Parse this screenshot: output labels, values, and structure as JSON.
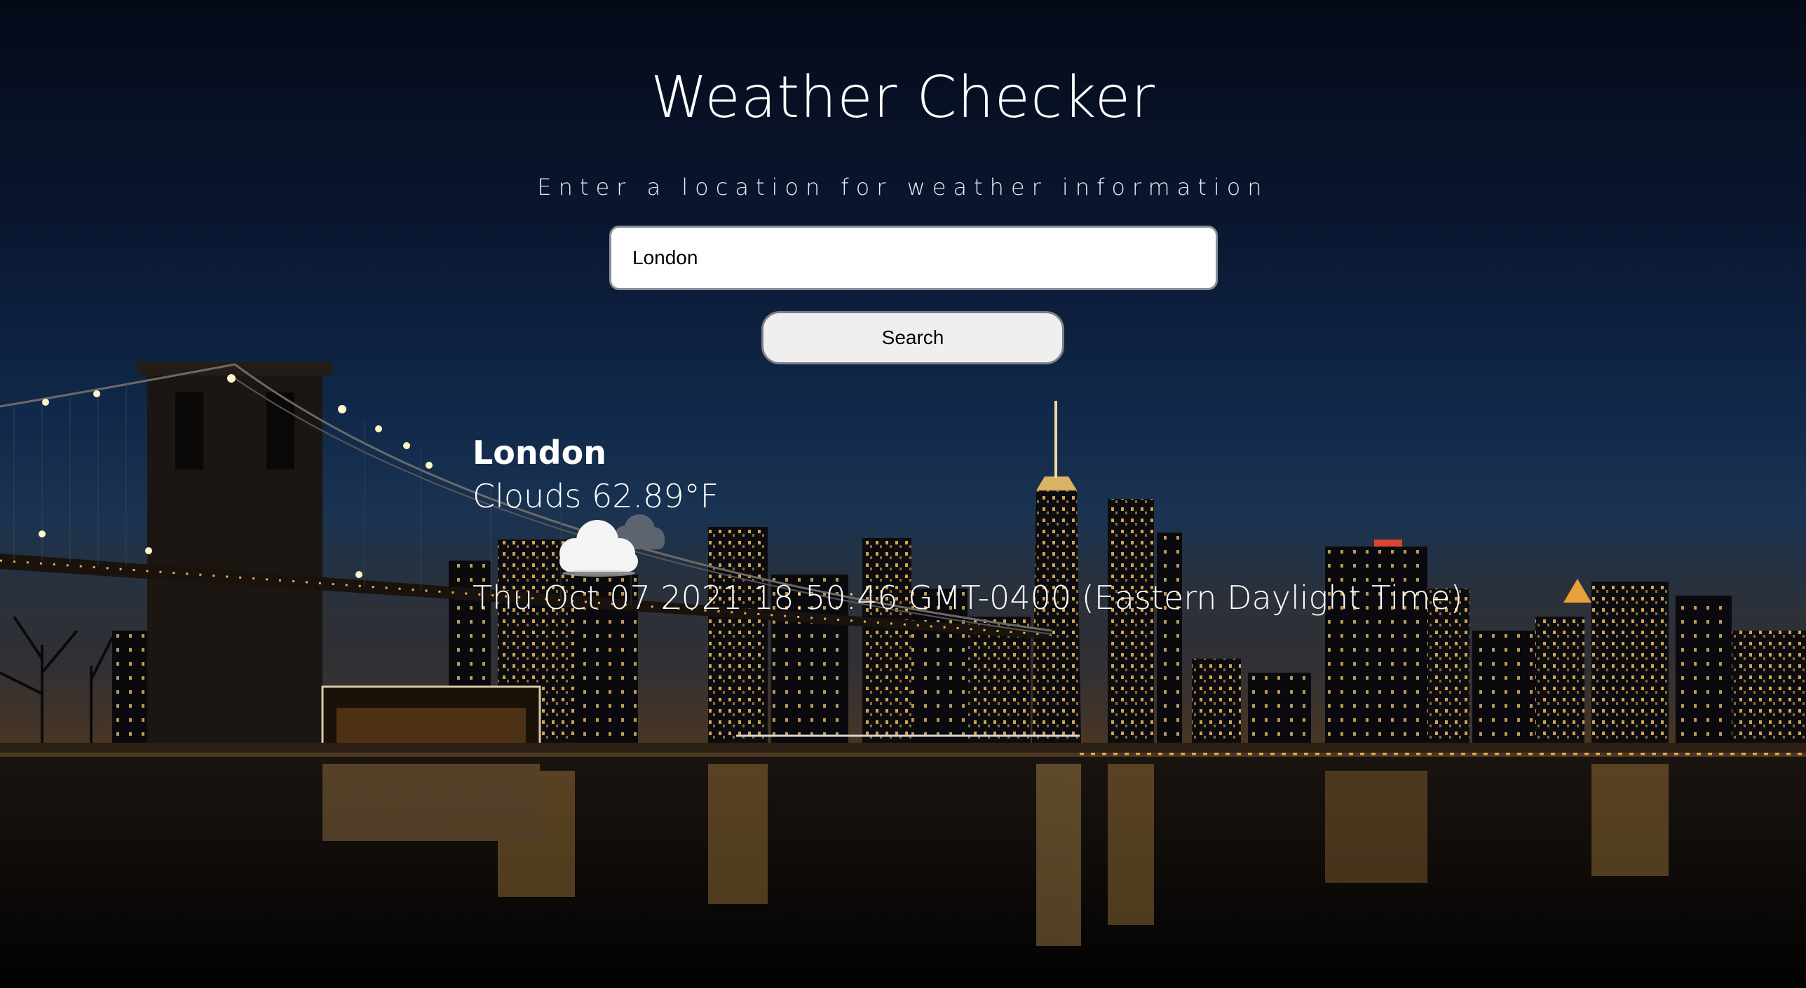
{
  "header": {
    "title": "Weather Checker",
    "subtitle": "Enter a location for weather information"
  },
  "search": {
    "value": "London",
    "button_label": "Search"
  },
  "result": {
    "city": "London",
    "conditions": "Clouds 62.89°F",
    "icon": "cloud-icon",
    "datetime": "Thu Oct 07 2021 18:50:46 GMT-0400 (Eastern Daylight Time)"
  },
  "colors": {
    "text": "#ffffff",
    "input_bg": "#ffffff",
    "button_bg": "#efefef",
    "sky_top": "#050a18",
    "city_lights": "#f5c35a"
  }
}
